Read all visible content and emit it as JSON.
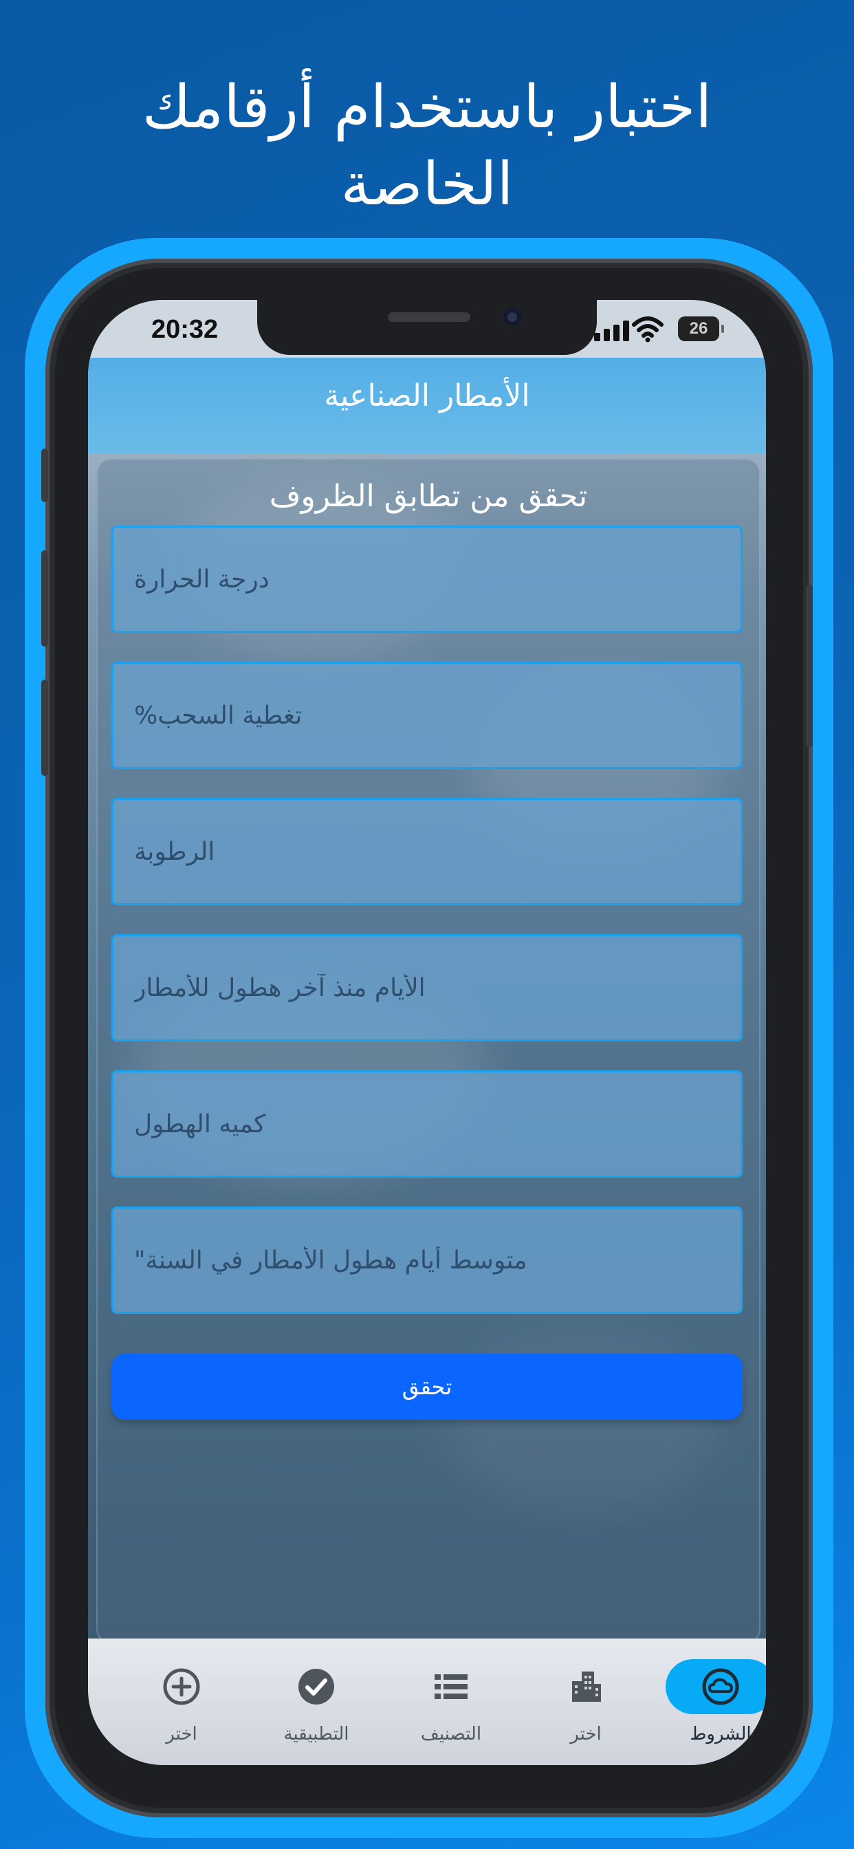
{
  "headline": {
    "line1": "اختبار باستخدام أرقامك",
    "line2": "الخاصة"
  },
  "status_bar": {
    "time": "20:32",
    "battery": "26"
  },
  "nav": {
    "title": "الأمطار الصناعية"
  },
  "form": {
    "title": "تحقق من تطابق الظروف",
    "fields": [
      {
        "placeholder": "درجة الحرارة"
      },
      {
        "placeholder": "تغطية السحب%"
      },
      {
        "placeholder": "الرطوبة"
      },
      {
        "placeholder": "الأيام منذ آخر هطول للأمطار"
      },
      {
        "placeholder": "كميه الهطول"
      },
      {
        "placeholder": "متوسط أيام هطول الأمطار في السنة\""
      }
    ],
    "submit_label": "تحقق"
  },
  "tabbar": {
    "items": [
      {
        "label": "اختر",
        "icon": "plus-circle-icon"
      },
      {
        "label": "التطبيقية",
        "icon": "checkmark-circle-icon"
      },
      {
        "label": "التصنيف",
        "icon": "list-icon"
      },
      {
        "label": "اختر",
        "icon": "building-icon"
      },
      {
        "label": "الشروط",
        "icon": "cloud-circle-icon",
        "active": true
      }
    ]
  },
  "colors": {
    "accent": "#0a66ff",
    "active_tab": "#06aaf5",
    "frame": "#16a7ff"
  }
}
